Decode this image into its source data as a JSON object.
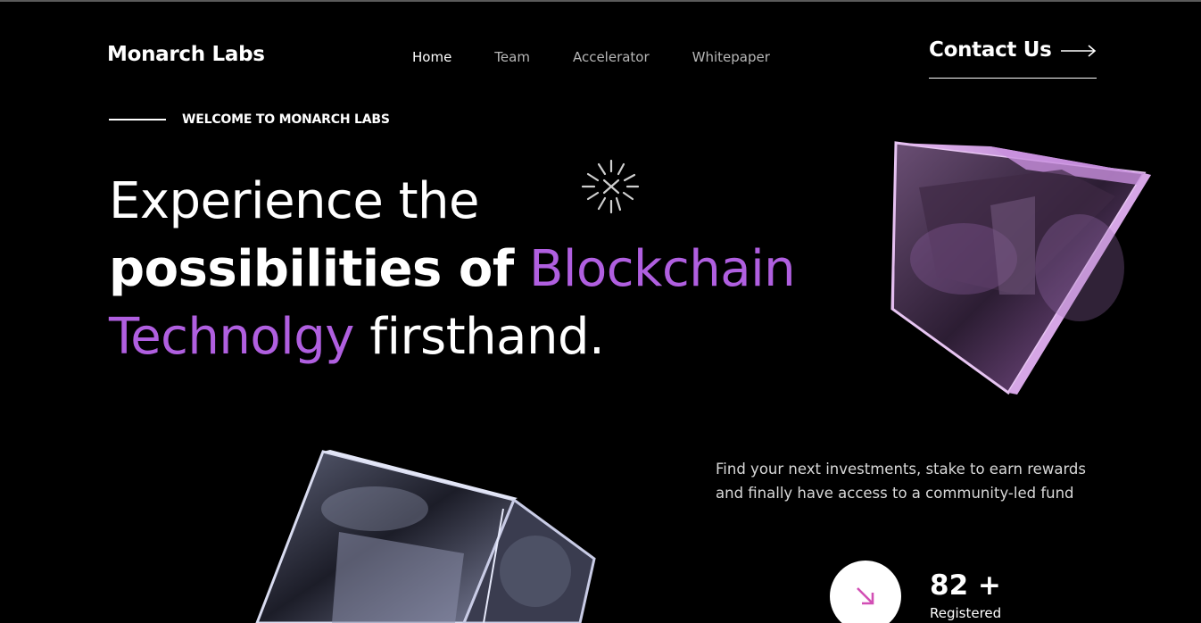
{
  "brand": {
    "name": "Monarch Labs"
  },
  "nav": {
    "items": [
      {
        "label": "Home"
      },
      {
        "label": "Team"
      },
      {
        "label": "Accelerator"
      },
      {
        "label": "Whitepaper"
      }
    ]
  },
  "contact": {
    "label": "Contact Us",
    "icon": "arrow-right-icon"
  },
  "hero": {
    "eyebrow": "WELCOME TO MONARCH LABS",
    "line1": "Experience the",
    "line2_white": "possibilities of",
    "line2_accent": "Blockchain",
    "line3_accent": "Technolgy",
    "line3_white": "firsthand.",
    "accent_color": "#b05fe0"
  },
  "tagline": "Find your next investments, stake to earn rewards and finally have access to a community-led fund",
  "stat": {
    "value": "82 +",
    "label": "Registered",
    "icon": "arrow-down-right-icon",
    "icon_color": "#d24fb5"
  }
}
